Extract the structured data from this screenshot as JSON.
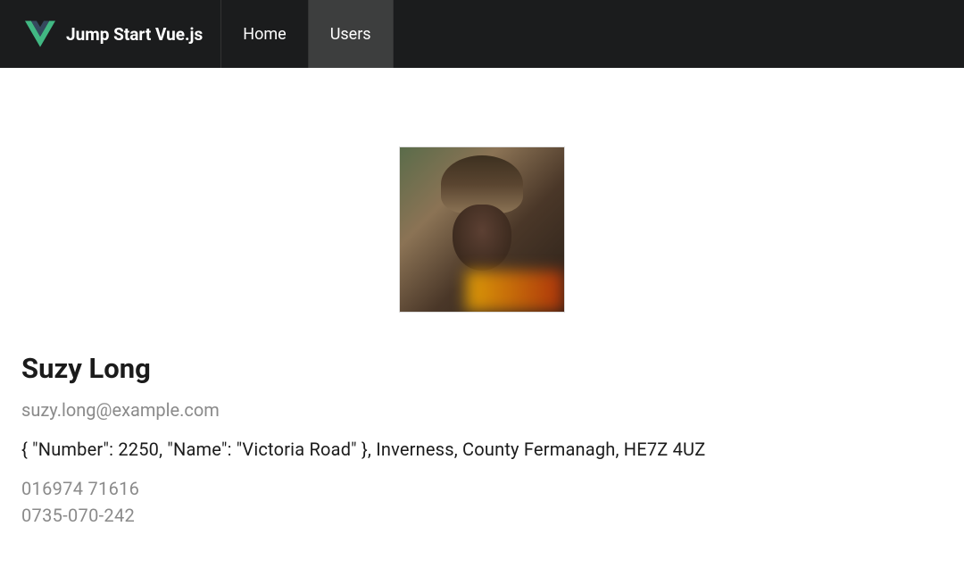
{
  "brand": {
    "title": "Jump Start Vue.js"
  },
  "nav": {
    "items": [
      {
        "label": "Home",
        "active": false
      },
      {
        "label": "Users",
        "active": true
      }
    ]
  },
  "user": {
    "name": "Suzy Long",
    "email": "suzy.long@example.com",
    "address": "{ \"Number\": 2250, \"Name\": \"Victoria Road\" }, Inverness, County Fermanagh, HE7Z 4UZ",
    "phone": "016974 71616",
    "cell": "0735-070-242"
  }
}
